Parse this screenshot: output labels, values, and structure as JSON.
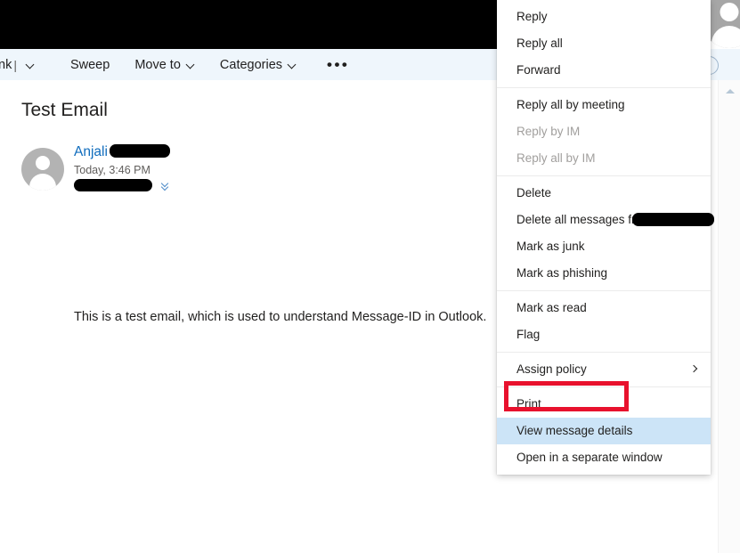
{
  "toolbar": {
    "junk_label": "nk",
    "junk_separator": "|",
    "sweep_label": "Sweep",
    "move_to_label": "Move to",
    "categories_label": "Categories",
    "more_label": "•••",
    "background_color": "#eff6fc"
  },
  "reading_pane": {
    "subject": "Test Email",
    "sender_name": "Anjali",
    "sender_name_color": "#0f6cbd",
    "timestamp": "Today, 3:46 PM",
    "body_text": "This is a test email, which is used to understand Message-ID in Outlook.",
    "avatar_icon": "person-avatar-icon",
    "recipient_expand_icon": "chevron-double-down-icon"
  },
  "scrollbar": {
    "up_arrow_icon": "scroll-up-arrow-icon"
  },
  "context_menu": {
    "highlight_color": "#cce4f7",
    "annotation_color": "#e8112d",
    "items": [
      {
        "label": "Reply",
        "state": "enabled"
      },
      {
        "label": "Reply all",
        "state": "enabled"
      },
      {
        "label": "Forward",
        "state": "enabled"
      },
      {
        "separator": true
      },
      {
        "label": "Reply all by meeting",
        "state": "enabled"
      },
      {
        "label": "Reply by IM",
        "state": "disabled"
      },
      {
        "label": "Reply all by IM",
        "state": "disabled"
      },
      {
        "separator": true
      },
      {
        "label": "Delete",
        "state": "enabled"
      },
      {
        "label": "Delete all messages from",
        "state": "enabled",
        "redacted_suffix": true
      },
      {
        "label": "Mark as junk",
        "state": "enabled"
      },
      {
        "label": "Mark as phishing",
        "state": "enabled"
      },
      {
        "separator": true
      },
      {
        "label": "Mark as read",
        "state": "enabled"
      },
      {
        "label": "Flag",
        "state": "enabled"
      },
      {
        "separator": true
      },
      {
        "label": "Assign policy",
        "state": "enabled",
        "submenu": true
      },
      {
        "separator": true
      },
      {
        "label": "Print",
        "state": "enabled"
      },
      {
        "label": "View message details",
        "state": "enabled",
        "highlighted": true,
        "annotated": true
      },
      {
        "label": "Open in a separate window",
        "state": "enabled"
      }
    ]
  }
}
